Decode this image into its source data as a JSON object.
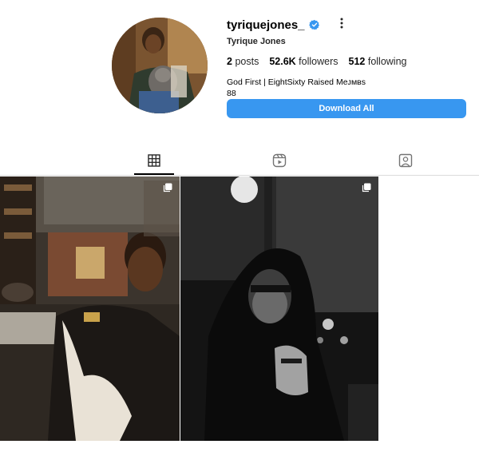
{
  "profile": {
    "username": "tyriquejones_",
    "full_name": "Tyrique Jones",
    "verified": true,
    "stats": {
      "posts_count": "2",
      "posts_label": "posts",
      "followers_count": "52.6K",
      "followers_label": "followers",
      "following_count": "512",
      "following_label": "following"
    },
    "bio_line1": "God First | EightSixty Raised Meᴊᴍʙs",
    "bio_line2": "88"
  },
  "actions": {
    "download_all_label": "Download All"
  },
  "tabs": [
    {
      "name": "posts",
      "icon": "grid-icon",
      "active": true
    },
    {
      "name": "reels",
      "icon": "reels-icon",
      "active": false
    },
    {
      "name": "tagged",
      "icon": "tagged-icon",
      "active": false
    }
  ],
  "posts": [
    {
      "kind": "color-photo",
      "icon": "multiple-posts-icon"
    },
    {
      "kind": "black-and-white-photo",
      "icon": "multiple-posts-icon"
    }
  ],
  "colors": {
    "accent": "#3897f0",
    "verified": "#3897f0",
    "divider": "#dbdbdb"
  }
}
